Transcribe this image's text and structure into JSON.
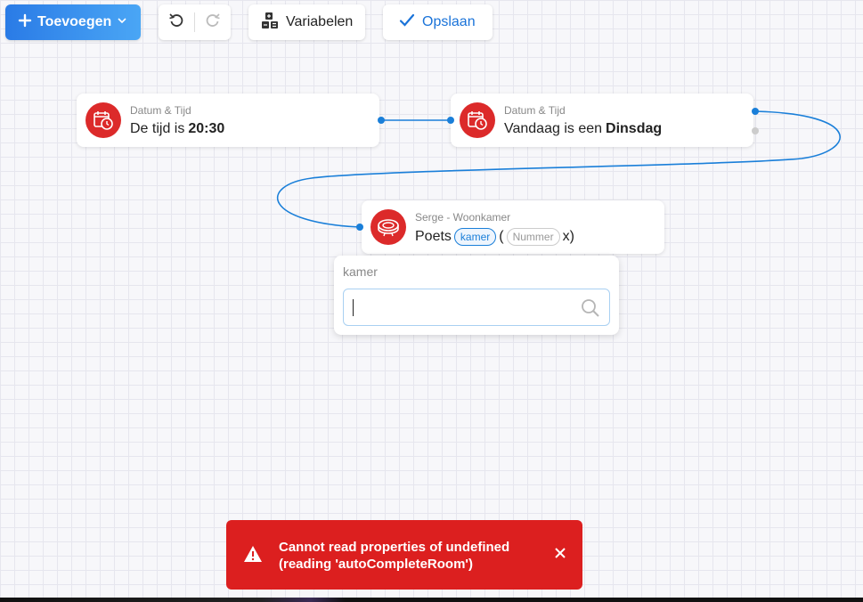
{
  "toolbar": {
    "add_label": "Toevoegen",
    "variables_label": "Variabelen",
    "save_label": "Opslaan"
  },
  "nodes": [
    {
      "title": "Datum & Tijd",
      "text": "De tijd is",
      "value": "20:30",
      "icon": "calendar-clock-icon"
    },
    {
      "title": "Datum & Tijd",
      "text": "Vandaag is een",
      "value": "Dinsdag",
      "icon": "calendar-clock-icon"
    },
    {
      "title": "Serge - Woonkamer",
      "text": "Poets",
      "arg1": "kamer",
      "open_paren": "(",
      "arg2": "Nummer",
      "suffix": "x)",
      "icon": "robot-vacuum-icon"
    }
  ],
  "dropdown": {
    "label": "kamer",
    "value": "",
    "placeholder": ""
  },
  "toast": {
    "message": "Cannot read properties of undefined (reading 'autoCompleteRoom')",
    "color": "#dc1f1f"
  },
  "colors": {
    "accent": "#1a7fd9",
    "node_icon": "#dc2a2a"
  }
}
